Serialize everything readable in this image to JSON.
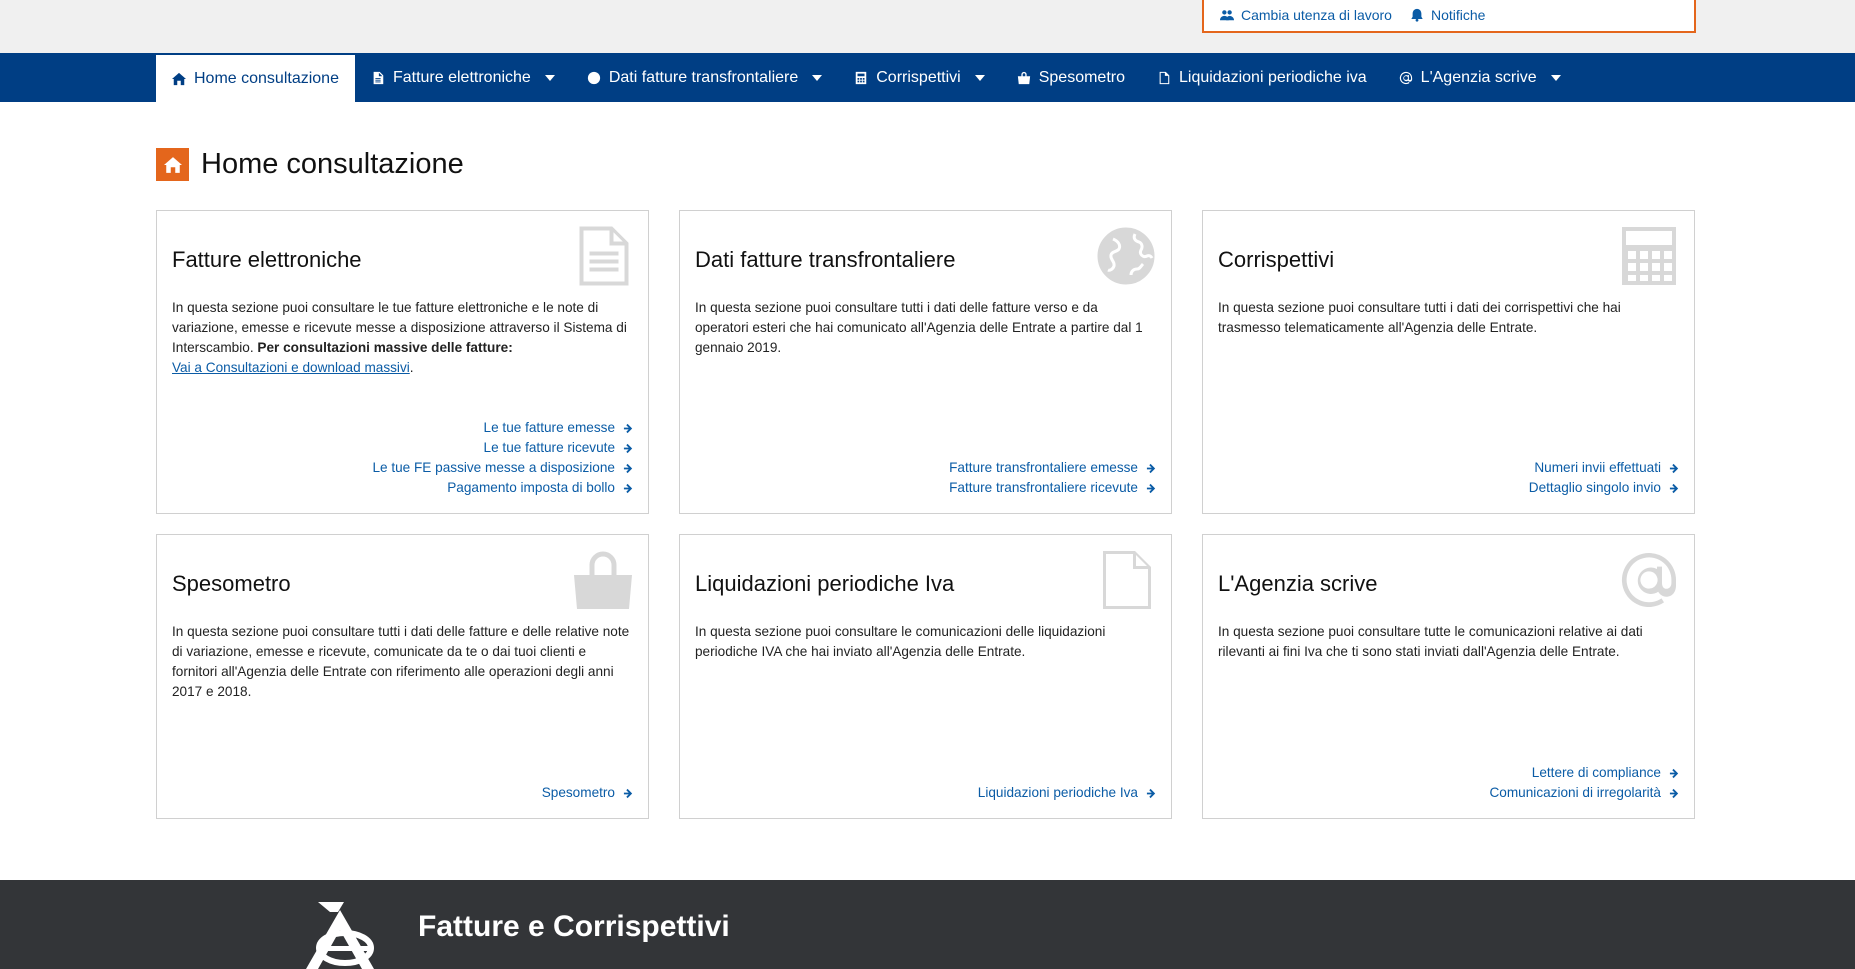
{
  "topbar": {
    "change_workspace": "Cambia utenza di lavoro",
    "notifications": "Notifiche"
  },
  "nav": {
    "items": [
      {
        "label": "Home consultazione",
        "icon": "home-icon",
        "dropdown": false,
        "active": true
      },
      {
        "label": "Fatture elettroniche",
        "icon": "document-icon",
        "dropdown": true,
        "active": false
      },
      {
        "label": "Dati fatture transfrontaliere",
        "icon": "globe-icon",
        "dropdown": true,
        "active": false
      },
      {
        "label": "Corrispettivi",
        "icon": "calculator-icon",
        "dropdown": true,
        "active": false
      },
      {
        "label": "Spesometro",
        "icon": "shopping-bag-icon",
        "dropdown": false,
        "active": false
      },
      {
        "label": "Liquidazioni periodiche iva",
        "icon": "file-icon",
        "dropdown": false,
        "active": false
      },
      {
        "label": "L'Agenzia scrive",
        "icon": "at-icon",
        "dropdown": true,
        "active": false
      }
    ]
  },
  "page": {
    "title": "Home consultazione"
  },
  "cards": {
    "fatture": {
      "title": "Fatture elettroniche",
      "desc": "In questa sezione puoi consultare le tue fatture elettroniche e le note di variazione, emesse e ricevute messe a disposizione attraverso il Sistema di Interscambio.",
      "desc_bold": "Per consultazioni massive delle fatture:",
      "desc_link": "Vai a Consultazioni e download massivi",
      "links": [
        "Le tue fatture emesse",
        "Le tue fatture ricevute",
        "Le tue FE passive messe a disposizione",
        "Pagamento imposta di bollo"
      ]
    },
    "transfrontaliere": {
      "title": "Dati fatture transfrontaliere",
      "desc": "In questa sezione puoi consultare tutti i dati delle fatture verso e da operatori esteri che hai comunicato all'Agenzia delle Entrate a partire dal 1 gennaio 2019.",
      "links": [
        "Fatture transfrontaliere emesse",
        "Fatture transfrontaliere ricevute"
      ]
    },
    "corrispettivi": {
      "title": "Corrispettivi",
      "desc": "In questa sezione puoi consultare tutti i dati dei corrispettivi che hai trasmesso telematicamente all'Agenzia delle Entrate.",
      "links": [
        "Numeri invii effettuati",
        "Dettaglio singolo invio"
      ]
    },
    "spesometro": {
      "title": "Spesometro",
      "desc": "In questa sezione puoi consultare tutti i dati delle fatture e delle relative note di variazione, emesse e ricevute, comunicate da te o dai tuoi clienti e fornitori all'Agenzia delle Entrate con riferimento alle operazioni degli anni 2017 e 2018.",
      "links": [
        "Spesometro"
      ]
    },
    "liquidazioni": {
      "title": "Liquidazioni periodiche Iva",
      "desc": "In questa sezione puoi consultare le comunicazioni delle liquidazioni periodiche IVA che hai inviato all'Agenzia delle Entrate.",
      "links": [
        "Liquidazioni periodiche Iva"
      ]
    },
    "agenzia": {
      "title": "L'Agenzia scrive",
      "desc": "In questa sezione puoi consultare tutte le comunicazioni relative ai dati rilevanti ai fini Iva che ti sono stati inviati dall'Agenzia delle Entrate.",
      "links": [
        "Lettere di compliance",
        "Comunicazioni di irregolarità"
      ]
    }
  },
  "footer": {
    "title": "Fatture e Corrispettivi"
  },
  "colors": {
    "nav_bg": "#003e84",
    "accent": "#e4661c",
    "link": "#0b5ca6",
    "footer_bg": "#333538"
  }
}
